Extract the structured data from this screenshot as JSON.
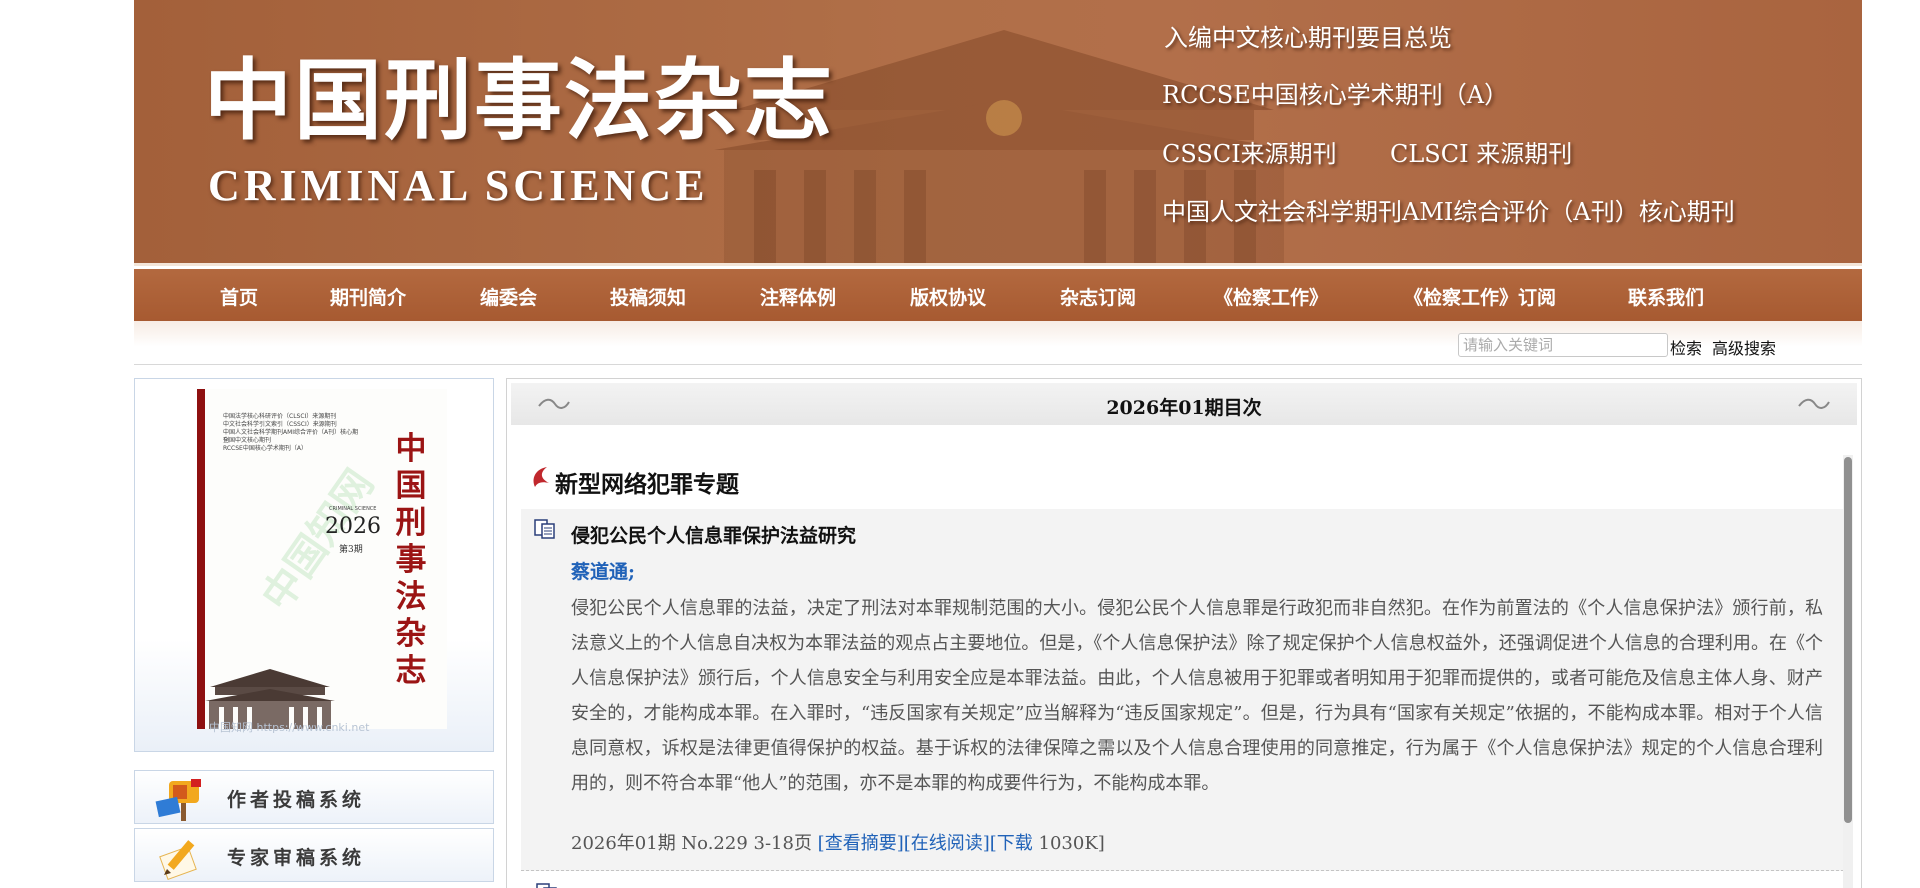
{
  "banner": {
    "title_cn": "中国刑事法杂志",
    "title_en": "CRIMINAL SCIENCE",
    "taglines": {
      "t1": "入编中文核心期刊要目总览",
      "t2": "RCCSE中国核心学术期刊（A）",
      "t3a": "CSSCI来源期刊",
      "t3b": "CLSCI 来源期刊",
      "t4": "中国人文社会科学期刊AMI综合评价（A刊）核心期刊"
    }
  },
  "nav": {
    "items": [
      "首页",
      "期刊简介",
      "编委会",
      "投稿须知",
      "注释体例",
      "版权协议",
      "杂志订阅",
      "《检察工作》",
      "《检察工作》订阅",
      "联系我们"
    ]
  },
  "search": {
    "placeholder": "请输入关键词",
    "search_label": "检索",
    "advanced_label": "高级搜索"
  },
  "sidebar": {
    "cover": {
      "title": "中国刑事法杂志",
      "year": "2026",
      "issue": "第3期",
      "english": "CRIMINAL SCIENCE",
      "small_lines": [
        "中国法学核心科研评价（CLSCI）来源期刊",
        "中文社会科学引文索引（CSSCI）来源期刊",
        "中国人文社会科学期刊AMI综合评价（A刊）核心期刊",
        "全国中文核心期刊",
        "RCCSE中国核心学术期刊（A）"
      ],
      "watermark": "中国知网 https://www.cnki.net"
    },
    "author_system": "作者投稿系统",
    "expert_system": "专家审稿系统"
  },
  "main": {
    "issue_title": "2026年01期目次",
    "section_title": "新型网络犯罪专题",
    "article": {
      "title": "侵犯公民个人信息罪保护法益研究",
      "author": "蔡道通;",
      "abstract": "侵犯公民个人信息罪的法益，决定了刑法对本罪规制范围的大小。侵犯公民个人信息罪是行政犯而非自然犯。在作为前置法的《个人信息保护法》颁行前，私法意义上的个人信息自决权为本罪法益的观点占主要地位。但是，《个人信息保护法》除了规定保护个人信息权益外，还强调促进个人信息的合理利用。在《个人信息保护法》颁行后，个人信息安全与利用安全应是本罪法益。由此，个人信息被用于犯罪或者明知用于犯罪而提供的，或者可能危及信息主体人身、财产安全的，才能构成本罪。在入罪时，“违反国家有关规定”应当解释为“违反国家规定”。但是，行为具有“国家有关规定”依据的，不能构成本罪。相对于个人信息同意权，诉权是法律更值得保护的权益。基于诉权的法律保障之需以及个人信息合理使用的同意推定，行为属于《个人信息保护法》规定的个人信息合理利用的，则不符合本罪“他人”的范围，亦不是本罪的构成要件行为，不能构成本罪。",
      "meta": "2026年01期 No.229 3-18页 ",
      "view_abstract": "[查看摘要]",
      "read_online": "[在线阅读]",
      "download": "[下载",
      "size": " 1030K]"
    }
  },
  "colors": {
    "banner": "#a9643f",
    "nav": "#ad6036",
    "link": "#2062b8",
    "section_icon": "#c0282d",
    "cover_red": "#9b1414"
  }
}
